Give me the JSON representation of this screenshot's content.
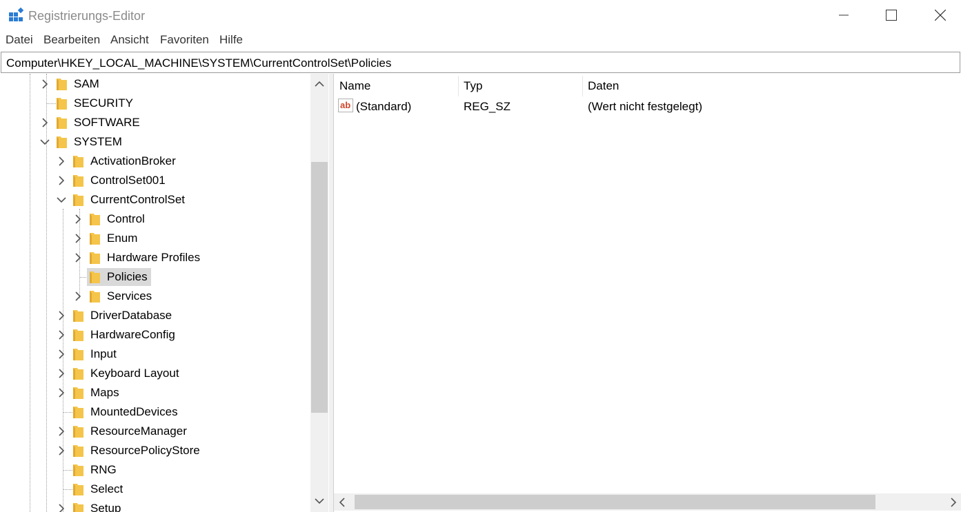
{
  "window": {
    "title": "Registrierungs-Editor"
  },
  "menu": [
    "Datei",
    "Bearbeiten",
    "Ansicht",
    "Favoriten",
    "Hilfe"
  ],
  "address": "Computer\\HKEY_LOCAL_MACHINE\\SYSTEM\\CurrentControlSet\\Policies",
  "tree": [
    {
      "label": "SAM",
      "level": 0,
      "expander": "collapsed"
    },
    {
      "label": "SECURITY",
      "level": 0,
      "expander": "none"
    },
    {
      "label": "SOFTWARE",
      "level": 0,
      "expander": "collapsed"
    },
    {
      "label": "SYSTEM",
      "level": 0,
      "expander": "expanded"
    },
    {
      "label": "ActivationBroker",
      "level": 1,
      "expander": "collapsed"
    },
    {
      "label": "ControlSet001",
      "level": 1,
      "expander": "collapsed"
    },
    {
      "label": "CurrentControlSet",
      "level": 1,
      "expander": "expanded"
    },
    {
      "label": "Control",
      "level": 2,
      "expander": "collapsed"
    },
    {
      "label": "Enum",
      "level": 2,
      "expander": "collapsed"
    },
    {
      "label": "Hardware Profiles",
      "level": 2,
      "expander": "collapsed"
    },
    {
      "label": "Policies",
      "level": 2,
      "expander": "none",
      "selected": true
    },
    {
      "label": "Services",
      "level": 2,
      "expander": "collapsed"
    },
    {
      "label": "DriverDatabase",
      "level": 1,
      "expander": "collapsed"
    },
    {
      "label": "HardwareConfig",
      "level": 1,
      "expander": "collapsed"
    },
    {
      "label": "Input",
      "level": 1,
      "expander": "collapsed"
    },
    {
      "label": "Keyboard Layout",
      "level": 1,
      "expander": "collapsed"
    },
    {
      "label": "Maps",
      "level": 1,
      "expander": "collapsed"
    },
    {
      "label": "MountedDevices",
      "level": 1,
      "expander": "none"
    },
    {
      "label": "ResourceManager",
      "level": 1,
      "expander": "collapsed"
    },
    {
      "label": "ResourcePolicyStore",
      "level": 1,
      "expander": "collapsed"
    },
    {
      "label": "RNG",
      "level": 1,
      "expander": "none"
    },
    {
      "label": "Select",
      "level": 1,
      "expander": "none"
    },
    {
      "label": "Setup",
      "level": 1,
      "expander": "collapsed"
    }
  ],
  "list": {
    "columns": [
      "Name",
      "Typ",
      "Daten"
    ],
    "rows": [
      {
        "icon": "string-value-icon",
        "name": "(Standard)",
        "type": "REG_SZ",
        "data": "(Wert nicht festgelegt)"
      }
    ]
  },
  "colors": {
    "folder": "#f4c54a",
    "selection": "#d9d9d9",
    "scrollbar": "#cdcdcd"
  }
}
